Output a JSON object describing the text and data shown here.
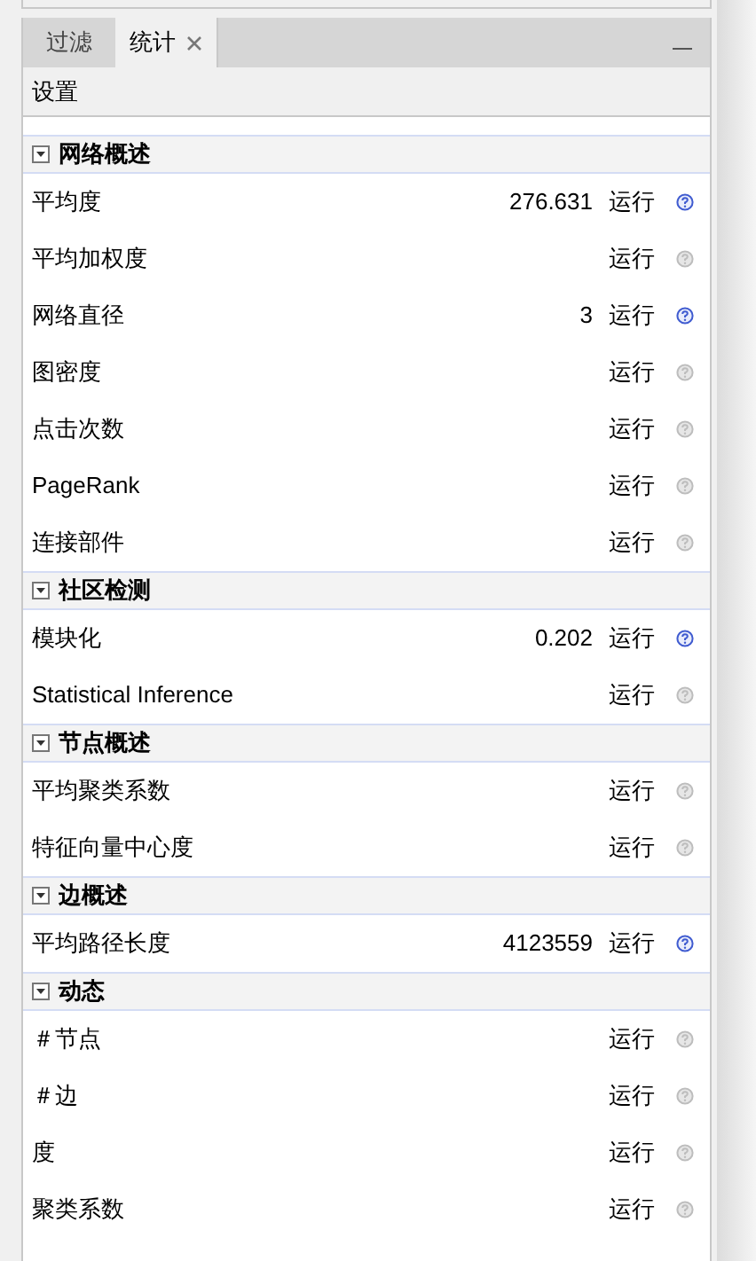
{
  "tabs": [
    {
      "label": "过滤",
      "selected": false,
      "closable": false
    },
    {
      "label": "统计",
      "selected": true,
      "closable": true
    }
  ],
  "settings": {
    "label": "设置"
  },
  "sections": [
    {
      "title": "网络概述",
      "expanded": true,
      "items": [
        {
          "name": "平均度",
          "result": "276.631",
          "action": "运行",
          "computed": true
        },
        {
          "name": "平均加权度",
          "action": "运行",
          "computed": false
        },
        {
          "name": "网络直径",
          "result": "3",
          "action": "运行",
          "computed": true
        },
        {
          "name": "图密度",
          "action": "运行",
          "computed": false
        },
        {
          "name": "点击次数",
          "action": "运行",
          "computed": false
        },
        {
          "name": "PageRank",
          "action": "运行",
          "computed": false
        },
        {
          "name": "连接部件",
          "action": "运行",
          "computed": false
        }
      ]
    },
    {
      "title": "社区检测",
      "expanded": true,
      "items": [
        {
          "name": "模块化",
          "result": "0.202",
          "action": "运行",
          "computed": true
        },
        {
          "name": "Statistical Inference",
          "action": "运行",
          "computed": false
        }
      ]
    },
    {
      "title": "节点概述",
      "expanded": true,
      "items": [
        {
          "name": "平均聚类系数",
          "action": "运行",
          "computed": false
        },
        {
          "name": "特征向量中心度",
          "action": "运行",
          "computed": false
        }
      ]
    },
    {
      "title": "边概述",
      "expanded": true,
      "items": [
        {
          "name": "平均路径长度",
          "result": "4123559",
          "action": "运行",
          "computed": true
        }
      ]
    },
    {
      "title": "动态",
      "expanded": true,
      "items": [
        {
          "name": "＃节点",
          "action": "运行",
          "computed": false
        },
        {
          "name": "＃边",
          "action": "运行",
          "computed": false
        },
        {
          "name": "度",
          "action": "运行",
          "computed": false
        },
        {
          "name": "聚类系数",
          "action": "运行",
          "computed": false
        }
      ]
    }
  ]
}
